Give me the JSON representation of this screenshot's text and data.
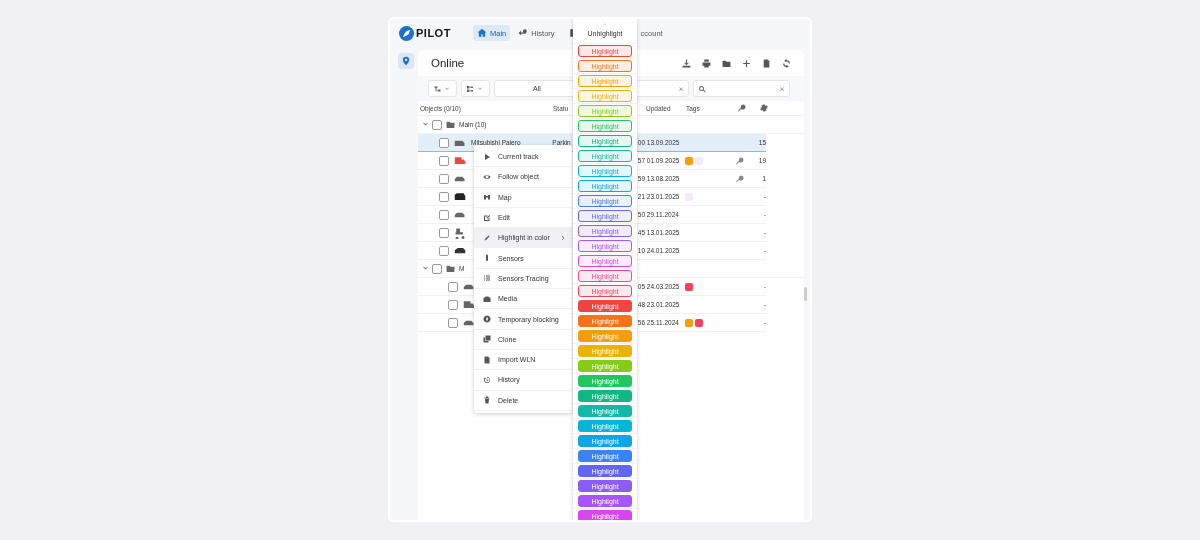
{
  "nav": {
    "logo": "PILOT",
    "tabs": [
      {
        "label": "Main",
        "selected": true
      },
      {
        "label": "History",
        "selected": false
      },
      {
        "label": "ccount",
        "selected": false
      }
    ]
  },
  "panel": {
    "title": "Online",
    "filter": {
      "value": "All"
    }
  },
  "table": {
    "columns": [
      "Objects (0/10)",
      "Statu",
      "Updated",
      "Tags"
    ],
    "groups": [
      {
        "name": "Main (10)",
        "expanded": true,
        "checked": false,
        "rows": [
          {
            "kind": "van",
            "name": "Mitsubishi Pajero",
            "status": "Parkin",
            "updated": "00 13.09.2025",
            "tags": [],
            "key": false,
            "count": "15",
            "checked": false,
            "selected": true
          },
          {
            "kind": "truck",
            "updated": "57 01.09.2025",
            "tags": [
              {
                "color": "#f59e0b"
              },
              {
                "color": "#f6e8fb"
              }
            ],
            "key": true,
            "count": "19",
            "checked": false,
            "selected": false
          },
          {
            "kind": "car",
            "updated": "59 13.08.2025",
            "tags": [],
            "key": true,
            "count": "1",
            "checked": false,
            "selected": false
          },
          {
            "kind": "minivan",
            "updated": "21 23.01.2025",
            "tags": [
              {
                "color": "#f6e8fb"
              }
            ],
            "key": false,
            "count": "-",
            "checked": false,
            "selected": false
          },
          {
            "kind": "car",
            "updated": "50 29.11.2024",
            "tags": [],
            "key": false,
            "count": "-",
            "checked": false,
            "selected": false
          },
          {
            "kind": "tractor",
            "updated": "45 13.01.2025",
            "tags": [],
            "key": false,
            "count": "-",
            "checked": false,
            "selected": false
          },
          {
            "kind": "suv",
            "updated": "10 24.01.2025",
            "tags": [],
            "key": false,
            "count": "-",
            "checked": false,
            "selected": false
          }
        ]
      },
      {
        "name": "M",
        "expanded": true,
        "checked": false,
        "rows": [
          {
            "kind": "car",
            "updated": "05 24.03.2025",
            "tags": [
              {
                "color": "#f43f5e"
              }
            ],
            "key": false,
            "count": "-",
            "checked": false,
            "selected": false
          },
          {
            "kind": "truck-grey",
            "updated": "48 23.01.2025",
            "tags": [],
            "key": false,
            "count": "-",
            "checked": false,
            "selected": false
          },
          {
            "kind": "car",
            "updated": "56 25.11.2024",
            "tags": [
              {
                "color": "#f59e0b"
              },
              {
                "color": "#f43f5e"
              }
            ],
            "key": false,
            "count": "-",
            "checked": false,
            "selected": false
          }
        ]
      }
    ]
  },
  "context_menu": {
    "items": [
      {
        "label": "Current track",
        "hovered": false,
        "submenu": false
      },
      {
        "label": "Follow object",
        "hovered": false,
        "submenu": false
      },
      {
        "label": "Map",
        "hovered": false,
        "submenu": false
      },
      {
        "label": "Edit",
        "hovered": false,
        "submenu": false
      },
      {
        "label": "Highlight in color",
        "hovered": true,
        "submenu": true
      },
      {
        "label": "Sensors",
        "hovered": false,
        "submenu": false
      },
      {
        "label": "Sensors Tracing",
        "hovered": false,
        "submenu": false
      },
      {
        "label": "Media",
        "hovered": false,
        "submenu": false
      },
      {
        "label": "Temporary blocking",
        "hovered": false,
        "submenu": false
      },
      {
        "label": "Clone",
        "hovered": false,
        "submenu": false
      },
      {
        "label": "Import WLN",
        "hovered": false,
        "submenu": false
      },
      {
        "label": "History",
        "hovered": false,
        "submenu": false
      },
      {
        "label": "Delete",
        "hovered": false,
        "submenu": false
      }
    ]
  },
  "color_menu": {
    "unhighlight": "Unhighlight",
    "items": [
      {
        "label": "Highlight",
        "kind": "light",
        "color": "#ef4444"
      },
      {
        "label": "Highlight",
        "kind": "light",
        "color": "#f97316"
      },
      {
        "label": "Highlight",
        "kind": "light",
        "color": "#f59e0b"
      },
      {
        "label": "Highlight",
        "kind": "light",
        "color": "#eab308"
      },
      {
        "label": "Highlight",
        "kind": "light",
        "color": "#84cc16"
      },
      {
        "label": "Highlight",
        "kind": "light",
        "color": "#22c55e"
      },
      {
        "label": "Highlight",
        "kind": "light",
        "color": "#10b981"
      },
      {
        "label": "Highlight",
        "kind": "light",
        "color": "#14b8a6"
      },
      {
        "label": "Highlight",
        "kind": "light",
        "color": "#06b6d4"
      },
      {
        "label": "Highlight",
        "kind": "light",
        "color": "#0ea5e9"
      },
      {
        "label": "Highlight",
        "kind": "light",
        "color": "#3b82f6"
      },
      {
        "label": "Highlight",
        "kind": "light",
        "color": "#6366f1"
      },
      {
        "label": "Highlight",
        "kind": "light",
        "color": "#8b5cf6"
      },
      {
        "label": "Highlight",
        "kind": "light",
        "color": "#a855f7"
      },
      {
        "label": "Highlight",
        "kind": "light",
        "color": "#d946ef"
      },
      {
        "label": "Highlight",
        "kind": "light",
        "color": "#ec4899"
      },
      {
        "label": "Highlight",
        "kind": "light",
        "color": "#f43f5e"
      },
      {
        "label": "Highlight",
        "kind": "solid",
        "color": "#ef4444"
      },
      {
        "label": "Highlight",
        "kind": "solid",
        "color": "#f97316"
      },
      {
        "label": "Highlight",
        "kind": "solid",
        "color": "#f59e0b"
      },
      {
        "label": "Highlight",
        "kind": "solid",
        "color": "#eab308"
      },
      {
        "label": "Highlight",
        "kind": "solid",
        "color": "#84cc16"
      },
      {
        "label": "Highlight",
        "kind": "solid",
        "color": "#22c55e"
      },
      {
        "label": "Highlight",
        "kind": "solid",
        "color": "#10b981"
      },
      {
        "label": "Highlight",
        "kind": "solid",
        "color": "#14b8a6"
      },
      {
        "label": "Highlight",
        "kind": "solid",
        "color": "#06b6d4"
      },
      {
        "label": "Highlight",
        "kind": "solid",
        "color": "#0ea5e9"
      },
      {
        "label": "Highlight",
        "kind": "solid",
        "color": "#3b82f6"
      },
      {
        "label": "Highlight",
        "kind": "solid",
        "color": "#6366f1"
      },
      {
        "label": "Highlight",
        "kind": "solid",
        "color": "#8b5cf6"
      },
      {
        "label": "Highlight",
        "kind": "solid",
        "color": "#a855f7"
      },
      {
        "label": "Highlight",
        "kind": "solid",
        "color": "#d946ef"
      }
    ]
  }
}
